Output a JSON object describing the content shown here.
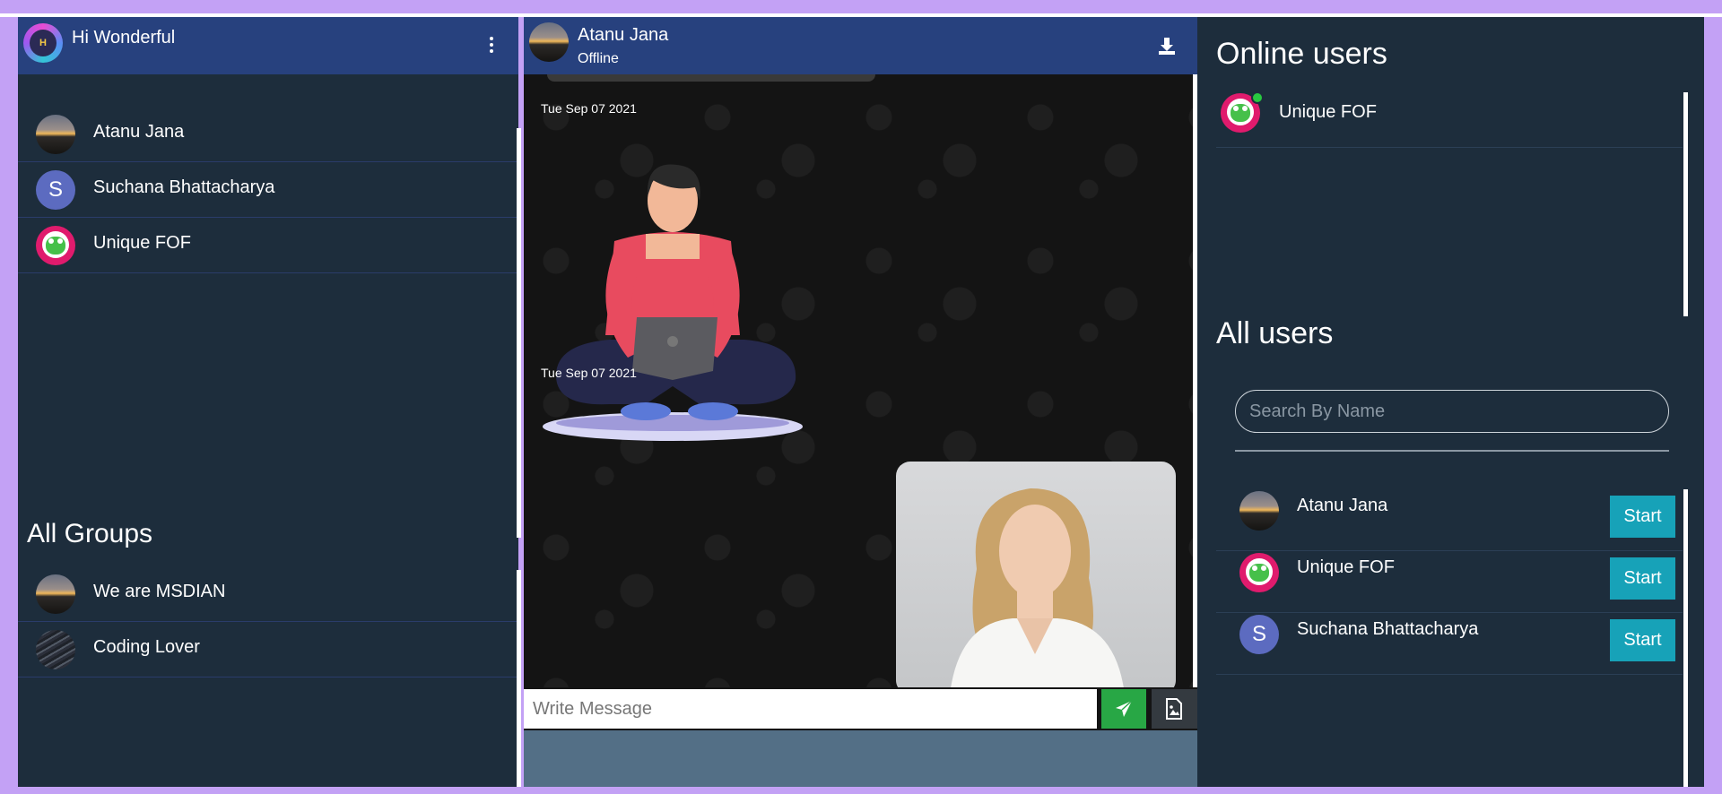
{
  "app": {
    "greeting": "Hi Wonderful",
    "logo_text": "H"
  },
  "sidebar": {
    "contacts": [
      {
        "name": "Atanu Jana",
        "avatar": "sunset"
      },
      {
        "name": "Suchana Bhattacharya",
        "avatar": "letter",
        "initial": "S"
      },
      {
        "name": "Unique FOF",
        "avatar": "fof"
      }
    ],
    "groups_title": "All Groups",
    "groups": [
      {
        "name": "We are MSDIAN",
        "avatar": "sunset"
      },
      {
        "name": "Coding Lover",
        "avatar": "code"
      }
    ]
  },
  "chat": {
    "contact_name": "Atanu Jana",
    "contact_status": "Offline",
    "messages": [
      {
        "date": "Tue Sep 07 2021",
        "type": "image",
        "content": "person-with-laptop-illustration"
      },
      {
        "date": "Tue Sep 07 2021",
        "type": "image",
        "content": "woman-portrait-photo"
      }
    ],
    "input_placeholder": "Write Message",
    "icons": {
      "download": "download-icon",
      "send": "send-icon",
      "attach": "image-file-icon"
    }
  },
  "right_panel": {
    "online_title": "Online users",
    "online_users": [
      {
        "name": "Unique FOF",
        "avatar": "fof"
      }
    ],
    "all_title": "All users",
    "search_placeholder": "Search By Name",
    "all_users": [
      {
        "name": "Atanu Jana",
        "avatar": "sunset",
        "button": "Start"
      },
      {
        "name": "Unique FOF",
        "avatar": "fof",
        "button": "Start"
      },
      {
        "name": "Suchana Bhattacharya",
        "avatar": "letter",
        "initial": "S",
        "button": "Start"
      }
    ]
  },
  "colors": {
    "page_bg": "#c3a1f5",
    "header_bg": "#27417e",
    "panel_bg": "#1d2d3c",
    "start_button": "#17a2b8",
    "send_button": "#28a745",
    "online_dot": "#28c840"
  }
}
